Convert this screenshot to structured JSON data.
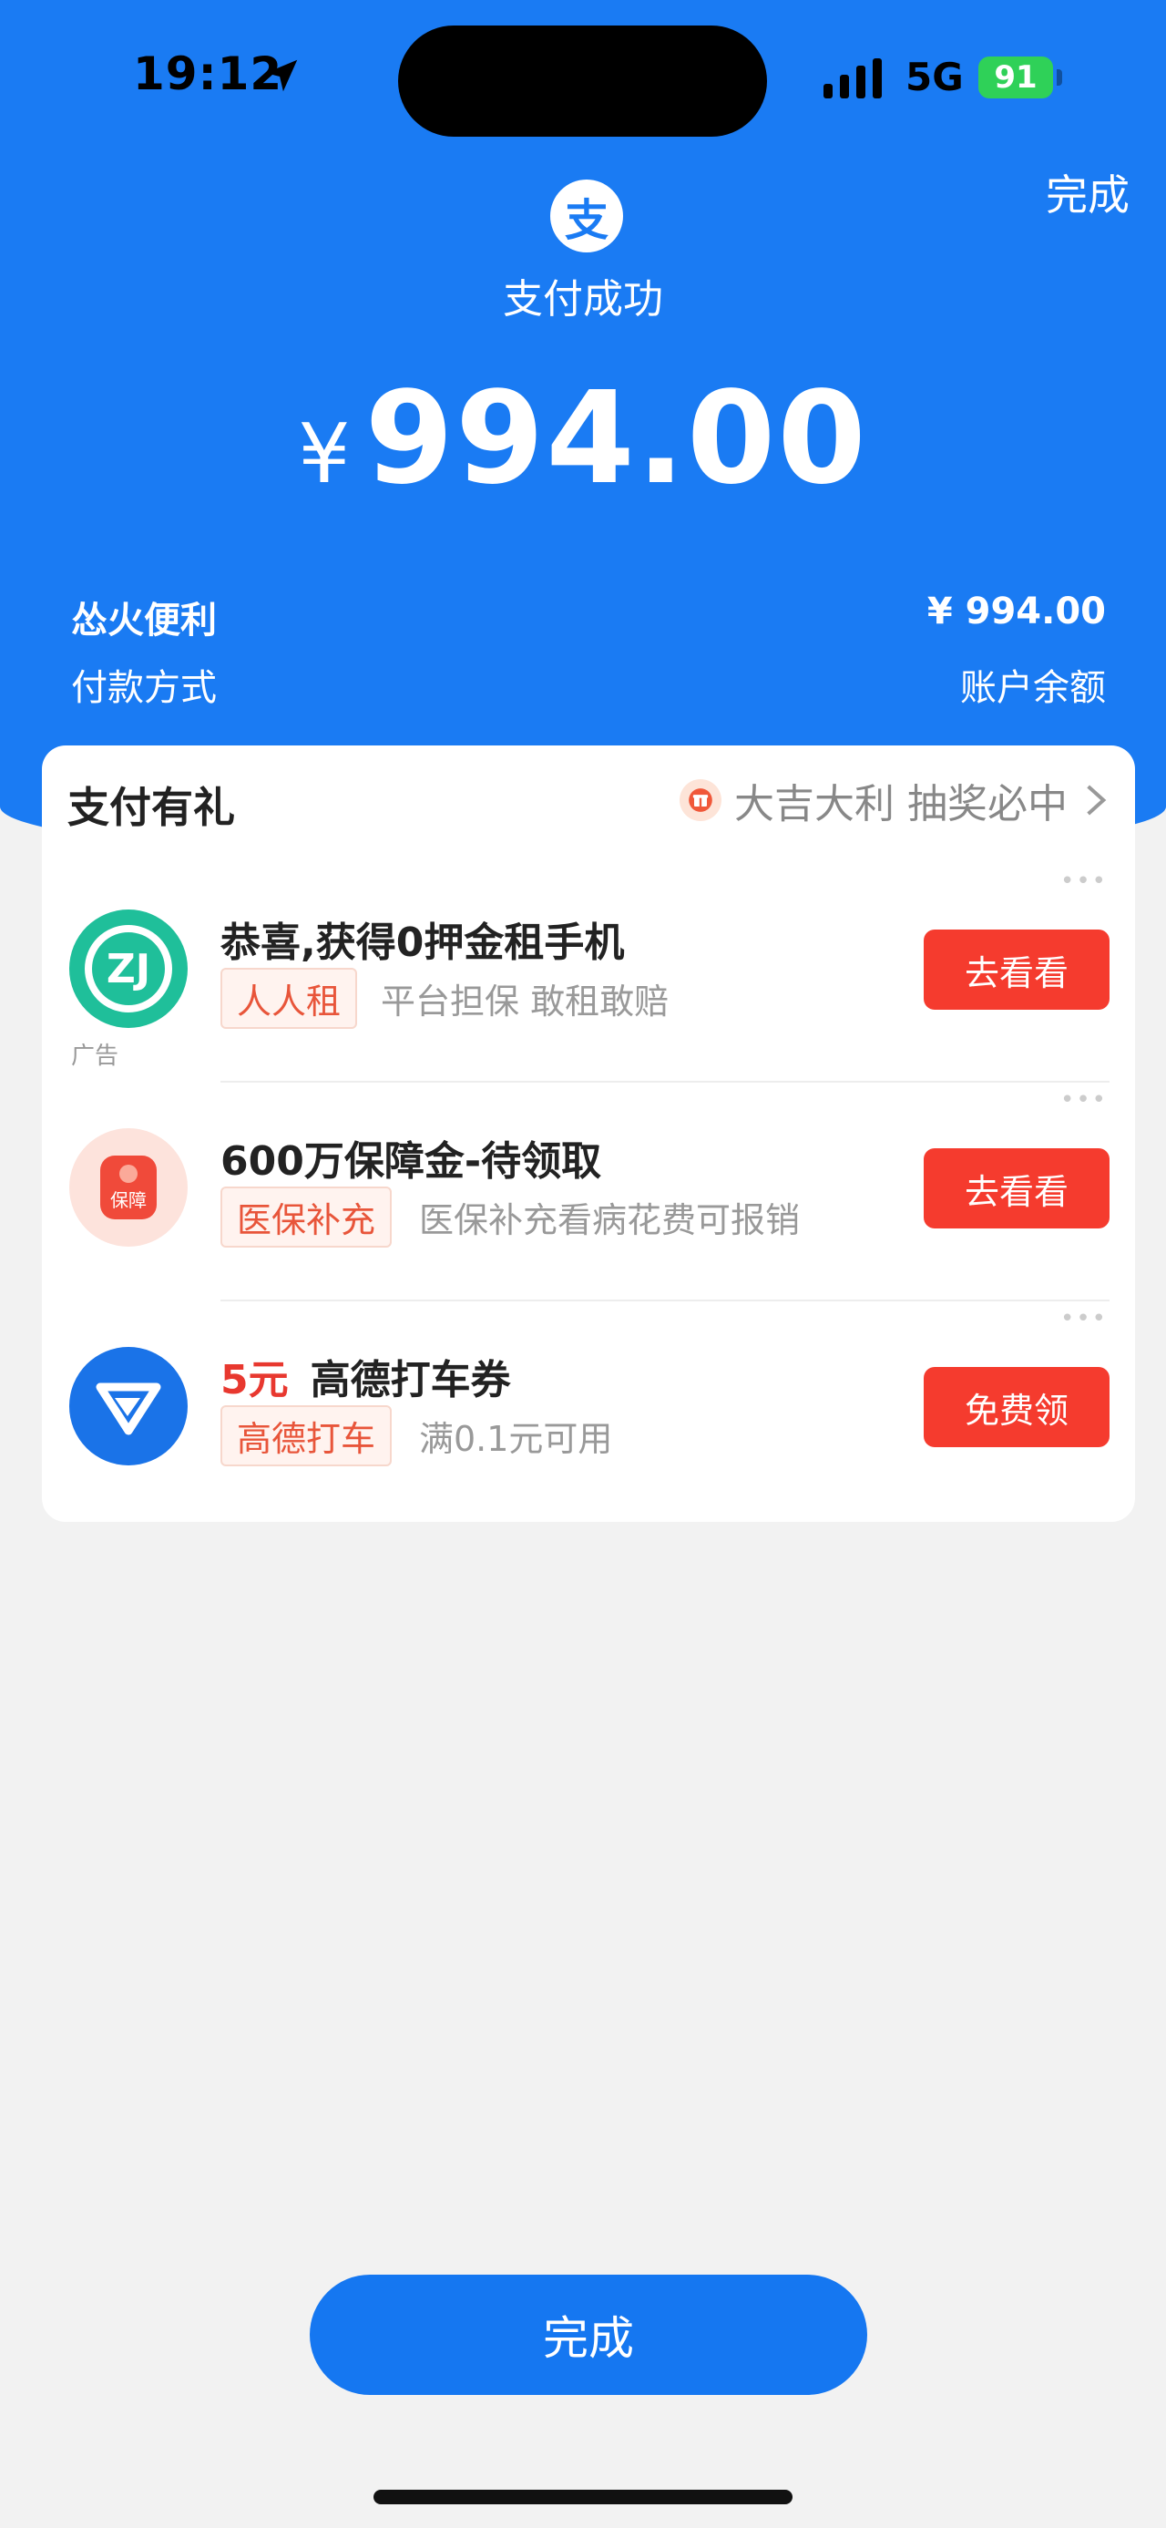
{
  "status_bar": {
    "time": "19:12",
    "network": "5G",
    "battery": "91"
  },
  "header": {
    "done_label": "完成",
    "logo_char": "支",
    "title": "支付成功",
    "currency": "¥",
    "amount": "994.00",
    "merchant": "怂火便利",
    "merchant_amount": "¥ 994.00",
    "payment_method_label": "付款方式",
    "payment_method_value": "账户余额"
  },
  "promo": {
    "title": "支付有礼",
    "lottery_text": "大吉大利 抽奖必中",
    "offers": [
      {
        "headline_prefix": "",
        "headline": "恭喜,获得0押金租手机",
        "tag": "人人租",
        "desc": "平台担保 敢租敢赔",
        "action": "去看看",
        "ad_label": "广告",
        "logo_text": "ZJ",
        "logo_color": "#1fbf9a"
      },
      {
        "headline_prefix": "",
        "headline": "600万保障金-待领取",
        "tag": "医保补充",
        "desc": "医保补充看病花费可报销",
        "action": "去看看",
        "ad_label": "",
        "logo_text": "保障",
        "logo_color": "#f25a4a"
      },
      {
        "headline_prefix": "5元",
        "headline": "高德打车券",
        "tag": "高德打车",
        "desc": "满0.1元可用",
        "action": "免费领",
        "ad_label": "",
        "logo_text": "",
        "logo_color": "#1a73e8"
      }
    ]
  },
  "footer": {
    "done_label": "完成"
  }
}
